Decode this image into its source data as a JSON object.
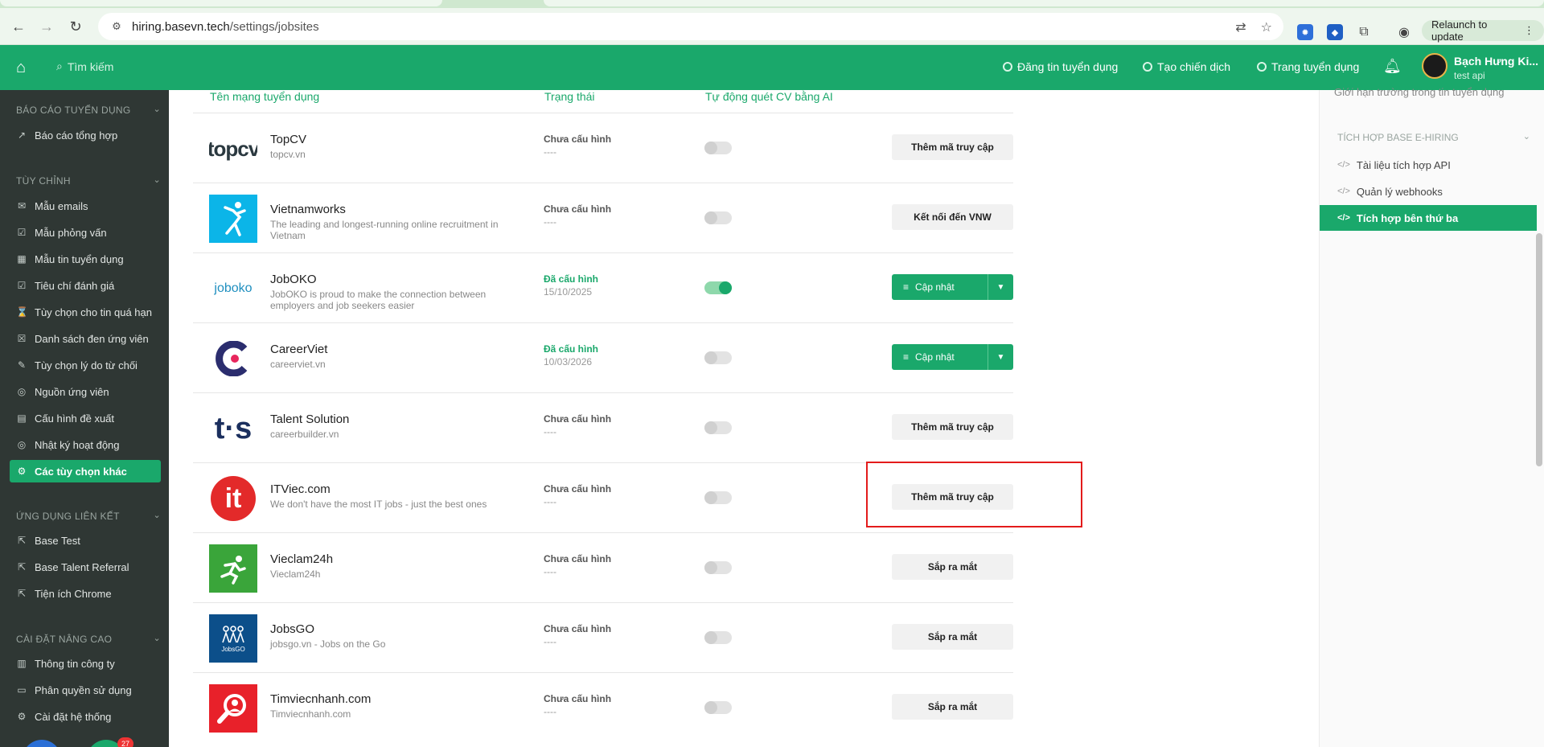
{
  "browser": {
    "url_domain": "hiring.basevn.tech",
    "url_path": "/settings/jobsites",
    "relaunch_label": "Relaunch to update"
  },
  "header": {
    "search_placeholder": "Tìm kiếm",
    "links": [
      "Đăng tin tuyển dụng",
      "Tạo chiến dịch",
      "Trang tuyển dụng"
    ],
    "user_name": "Bạch Hưng Ki...",
    "user_sub": "test api"
  },
  "sidebar": {
    "sections": [
      {
        "title": "BÁO CÁO TUYỂN DỤNG",
        "items": [
          "Báo cáo tổng hợp"
        ]
      },
      {
        "title": "TÙY CHỈNH",
        "items": [
          "Mẫu emails",
          "Mẫu phỏng vấn",
          "Mẫu tin tuyển dụng",
          "Tiêu chí đánh giá",
          "Tùy chọn cho tin quá hạn",
          "Danh sách đen ứng viên",
          "Tùy chọn lý do từ chối",
          "Nguồn ứng viên",
          "Cấu hình đề xuất",
          "Nhật ký hoạt động",
          "Các tùy chọn khác"
        ]
      },
      {
        "title": "ỨNG DỤNG LIÊN KẾT",
        "items": [
          "Base Test",
          "Base Talent Referral",
          "Tiện ích Chrome"
        ]
      },
      {
        "title": "CÀI ĐẶT NÂNG CAO",
        "items": [
          "Thông tin công ty",
          "Phân quyền sử dụng",
          "Cài đặt hệ thống"
        ]
      }
    ],
    "active_item": "Các tùy chọn khác",
    "badge": "27"
  },
  "table": {
    "headers": [
      "Tên mạng tuyển dụng",
      "Trạng thái",
      "Tự động quét CV bằng AI"
    ],
    "rows": [
      {
        "name": "TopCV",
        "desc": "topcv.vn",
        "status": "Chưa cấu hình",
        "date": "----",
        "toggle": false,
        "action": "Thêm mã truy cập",
        "logo": "topcv"
      },
      {
        "name": "Vietnamworks",
        "desc": "The leading and longest-running online recruitment in Vietnam",
        "status": "Chưa cấu hình",
        "date": "----",
        "toggle": false,
        "action": "Kết nối đến VNW",
        "logo": "vnw"
      },
      {
        "name": "JobOKO",
        "desc": "JobOKO is proud to make the connection between employers and job seekers easier",
        "status": "Đã cấu hình",
        "date": "15/10/2025",
        "toggle": true,
        "action": "Cập nhật",
        "logo": "joboko"
      },
      {
        "name": "CareerViet",
        "desc": "careerviet.vn",
        "status": "Đã cấu hình",
        "date": "10/03/2026",
        "toggle": false,
        "action": "Cập nhật",
        "logo": "careerviet"
      },
      {
        "name": "Talent Solution",
        "desc": "careerbuilder.vn",
        "status": "Chưa cấu hình",
        "date": "----",
        "toggle": false,
        "action": "Thêm mã truy cập",
        "logo": "ts"
      },
      {
        "name": "ITViec.com",
        "desc": "We don't have the most IT jobs - just the best ones",
        "status": "Chưa cấu hình",
        "date": "----",
        "toggle": false,
        "action": "Thêm mã truy cập",
        "logo": "itviec"
      },
      {
        "name": "Vieclam24h",
        "desc": "Vieclam24h",
        "status": "Chưa cấu hình",
        "date": "----",
        "toggle": false,
        "action": "Sắp ra mắt",
        "logo": "vieclam24h"
      },
      {
        "name": "JobsGO",
        "desc": "jobsgo.vn - Jobs on the Go",
        "status": "Chưa cấu hình",
        "date": "----",
        "toggle": false,
        "action": "Sắp ra mắt",
        "logo": "jobsgo"
      },
      {
        "name": "Timviecnhanh.com",
        "desc": "Timviecnhanh.com",
        "status": "Chưa cấu hình",
        "date": "----",
        "toggle": false,
        "action": "Sắp ra mắt",
        "logo": "timviecnhanh"
      }
    ]
  },
  "logos": {
    "topcv_text": "topcv",
    "ts_text": "t·s",
    "itviec_text": "it",
    "joboko_text": "joboko",
    "jobsgo_text": "JobsGO"
  },
  "right_panel": {
    "clipped_item": "Giới hạn trường trong tin tuyển dụng",
    "section_title": "TÍCH HỢP BASE E-HIRING",
    "items": [
      "Tài liệu tích hợp API",
      "Quản lý webhooks",
      "Tích hợp bên thứ ba"
    ],
    "active_item": "Tích hợp bên thứ ba"
  },
  "colors": {
    "brand_green": "#1aa86b",
    "sidebar_bg": "#2f3734",
    "highlight_red": "#e31b1b"
  }
}
